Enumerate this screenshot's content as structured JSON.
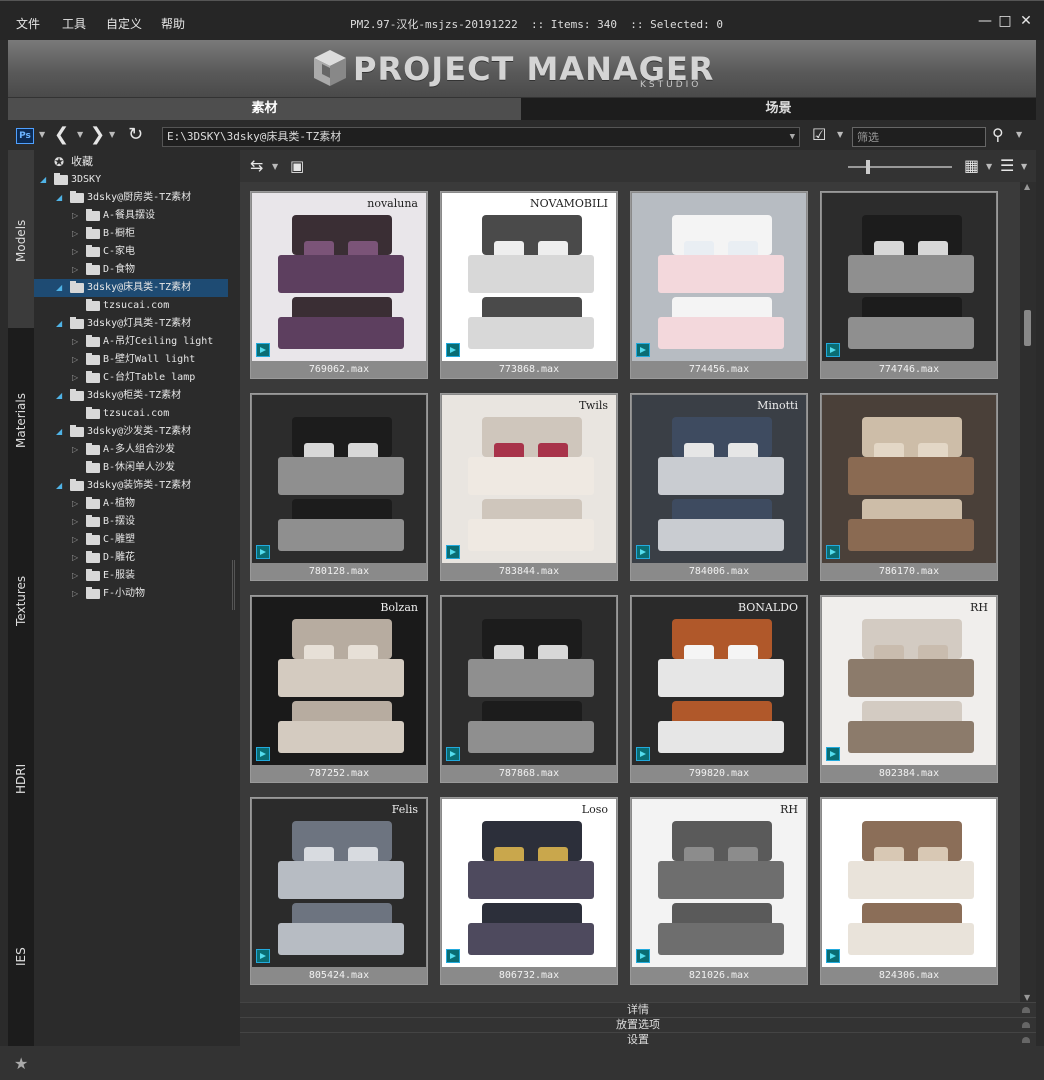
{
  "menu": {
    "file": "文件",
    "tools": "工具",
    "custom": "自定义",
    "help": "帮助"
  },
  "window": {
    "title": "PM2.97-汉化-msjzs-20191222  :: Items: 340  :: Selected: 0",
    "minimize_glyph": "—",
    "maximize_glyph": "□",
    "close_glyph": "✕"
  },
  "banner": {
    "title": "PROJECT MANAGER",
    "subtitle": "KSTUDIO"
  },
  "main_tabs": {
    "materials": "素材",
    "scenes": "场景"
  },
  "toolbar": {
    "ps_label": "Ps",
    "path": "E:\\3DSKY\\3dsky@床具类-TZ素材",
    "filter_placeholder": "筛选"
  },
  "side_tabs": [
    "Models",
    "Materials",
    "Textures",
    "HDRI",
    "IES"
  ],
  "tree": [
    {
      "label": "收藏",
      "toggle": "",
      "kind": "star"
    },
    {
      "label": "3DSKY",
      "toggle": "◢",
      "kind": "folder"
    },
    {
      "label": "3dsky@厨房类-TZ素材",
      "toggle": "◢",
      "kind": "folder"
    },
    {
      "label": "A-餐具摆设",
      "toggle": "▷",
      "kind": "folder"
    },
    {
      "label": "B-橱柜",
      "toggle": "▷",
      "kind": "folder"
    },
    {
      "label": "C-家电",
      "toggle": "▷",
      "kind": "folder"
    },
    {
      "label": "D-食物",
      "toggle": "▷",
      "kind": "folder"
    },
    {
      "label": "3dsky@床具类-TZ素材",
      "toggle": "◢",
      "kind": "folder"
    },
    {
      "label": "tzsucai.com",
      "toggle": "",
      "kind": "folder"
    },
    {
      "label": "3dsky@灯具类-TZ素材",
      "toggle": "◢",
      "kind": "folder"
    },
    {
      "label": "A-吊灯Ceiling light",
      "toggle": "▷",
      "kind": "folder"
    },
    {
      "label": "B-壁灯Wall light",
      "toggle": "▷",
      "kind": "folder"
    },
    {
      "label": "C-台灯Table lamp",
      "toggle": "▷",
      "kind": "folder"
    },
    {
      "label": "3dsky@柜类-TZ素材",
      "toggle": "◢",
      "kind": "folder"
    },
    {
      "label": "tzsucai.com",
      "toggle": "",
      "kind": "folder"
    },
    {
      "label": "3dsky@沙发类-TZ素材",
      "toggle": "◢",
      "kind": "folder"
    },
    {
      "label": "A-多人组合沙发",
      "toggle": "▷",
      "kind": "folder"
    },
    {
      "label": "B-休闲单人沙发",
      "toggle": "",
      "kind": "folder"
    },
    {
      "label": "3dsky@装饰类-TZ素材",
      "toggle": "◢",
      "kind": "folder"
    },
    {
      "label": "A-植物",
      "toggle": "▷",
      "kind": "folder"
    },
    {
      "label": "B-摆设",
      "toggle": "▷",
      "kind": "folder"
    },
    {
      "label": "C-雕塑",
      "toggle": "▷",
      "kind": "folder"
    },
    {
      "label": "D-雕花",
      "toggle": "▷",
      "kind": "folder"
    },
    {
      "label": "E-服装",
      "toggle": "▷",
      "kind": "folder"
    },
    {
      "label": "F-小动物",
      "toggle": "▷",
      "kind": "folder"
    }
  ],
  "thumbnails": [
    {
      "file": "769062.max",
      "brand": "novaluna",
      "palette": "purple"
    },
    {
      "file": "773868.max",
      "brand": "NOVAMOBILI",
      "palette": "gray"
    },
    {
      "file": "774456.max",
      "brand": "",
      "palette": "nursery"
    },
    {
      "file": "774746.max",
      "brand": "",
      "palette": "dark"
    },
    {
      "file": "780128.max",
      "brand": "",
      "palette": "dark"
    },
    {
      "file": "783844.max",
      "brand": "Twils",
      "palette": "cream"
    },
    {
      "file": "784006.max",
      "brand": "Minotti",
      "palette": "blue"
    },
    {
      "file": "786170.max",
      "brand": "",
      "palette": "brown"
    },
    {
      "file": "787252.max",
      "brand": "Bolzan",
      "palette": "beige"
    },
    {
      "file": "787868.max",
      "brand": "",
      "palette": "dark"
    },
    {
      "file": "799820.max",
      "brand": "BONALDO",
      "palette": "orange"
    },
    {
      "file": "802384.max",
      "brand": "RH",
      "palette": "taupe"
    },
    {
      "file": "805424.max",
      "brand": "Felis",
      "palette": "grayblue"
    },
    {
      "file": "806732.max",
      "brand": "Loso",
      "palette": "navy"
    },
    {
      "file": "821026.max",
      "brand": "RH",
      "palette": "charcoal"
    },
    {
      "file": "824306.max",
      "brand": "",
      "palette": "warm"
    }
  ],
  "collapse_bars": {
    "details": "详情",
    "placement": "放置选项",
    "settings": "设置"
  },
  "status": {
    "star_glyph": "★"
  }
}
